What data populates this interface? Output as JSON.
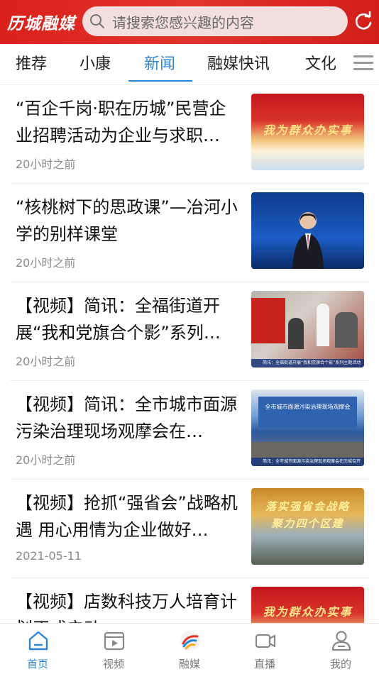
{
  "header": {
    "logo_text": "历城融媒",
    "search_placeholder": "请搜索您感兴趣的内容"
  },
  "tabs": [
    {
      "label": "推荐",
      "active": false
    },
    {
      "label": "小康",
      "active": false
    },
    {
      "label": "新闻",
      "active": true
    },
    {
      "label": "融媒快讯",
      "active": false
    },
    {
      "label": "文化",
      "active": false
    }
  ],
  "news": [
    {
      "title": "“百企千岗·职在历城”民营企业招聘活动为企业与求职…",
      "time": "20小时之前",
      "thumb": "red-banner",
      "thumb_text": "我为群众办实事"
    },
    {
      "title": "“核桃树下的思政课”—冶河小学的别样课堂",
      "time": "20小时之前",
      "thumb": "news-anchor"
    },
    {
      "title": "【视频】简讯：全福街道开展“我和党旗合个影”系列…",
      "time": "20小时之前",
      "thumb": "party-flag-photo",
      "thumb_caption": "简讯：全福街道开展“我和党旗合个影”系列主题活动"
    },
    {
      "title": "【视频】简讯：全市城市面源污染治理现场观摩会在…",
      "time": "20小时之前",
      "thumb": "meeting",
      "thumb_screen_text": "全市城市面源污染治理现场观摩会",
      "thumb_caption": "简讯：全市城市面源污染治理现场观摩会在历城召开"
    },
    {
      "title": "【视频】抢抓“强省会”战略机遇 用心用情为企业做好…",
      "time": "2021-05-11",
      "thumb": "city-banner",
      "thumb_text": "落实强省会战略 聚力四个区建"
    },
    {
      "title": "【视频】店数科技万人培育计划正式启动",
      "time": "",
      "thumb": "red-banner",
      "thumb_text": "我为群众办实事"
    }
  ],
  "bottom_nav": [
    {
      "label": "首页",
      "icon": "home-icon",
      "active": true
    },
    {
      "label": "视频",
      "icon": "video-icon",
      "active": false
    },
    {
      "label": "融媒",
      "icon": "rongmei-logo-icon",
      "active": false
    },
    {
      "label": "直播",
      "icon": "live-camera-icon",
      "active": false
    },
    {
      "label": "我的",
      "icon": "profile-icon",
      "active": false
    }
  ],
  "colors": {
    "brand_red": "#d9211b",
    "accent_blue": "#2c86d6"
  }
}
